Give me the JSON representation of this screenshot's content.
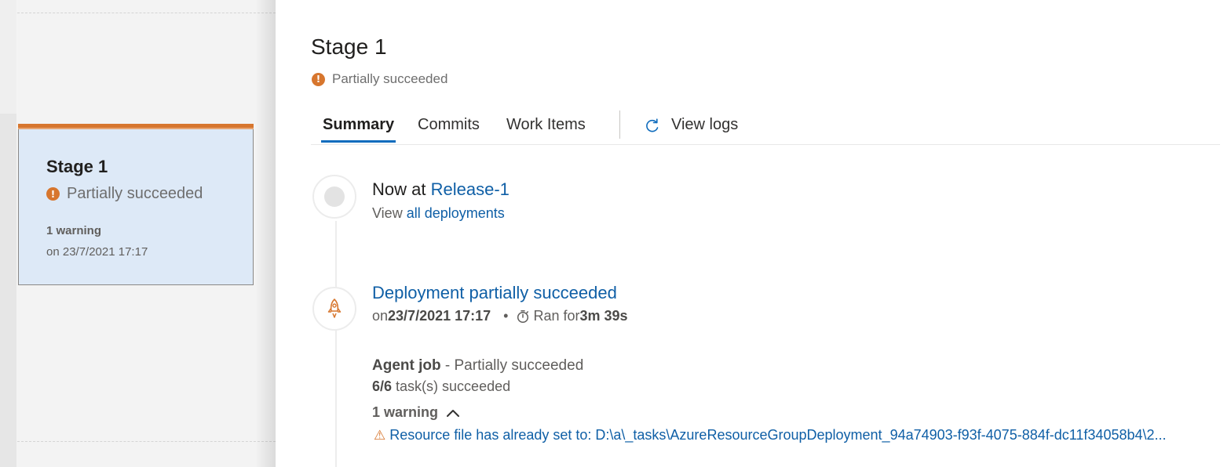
{
  "pipeline_card": {
    "title": "Stage 1",
    "status": "Partially succeeded",
    "warnings": "1 warning",
    "date": "on 23/7/2021 17:17",
    "status_color": "#d7762e"
  },
  "panel": {
    "title": "Stage 1",
    "status": "Partially succeeded",
    "tabs": [
      {
        "label": "Summary",
        "active": true
      },
      {
        "label": "Commits"
      },
      {
        "label": "Work Items"
      }
    ],
    "view_logs": "View logs",
    "now_at_prefix": "Now at",
    "release": "Release-1",
    "view_prefix": "View",
    "all_deployments": "all deployments",
    "deployment": {
      "title": "Deployment partially succeeded",
      "on_prefix": "on",
      "date": "23/7/2021 17:17",
      "bullet": "•",
      "ran_for_prefix": "Ran for",
      "duration": "3m 39s"
    },
    "agent_job": {
      "name": "Agent job",
      "separator": " - ",
      "status": "Partially succeeded",
      "tasks_count": "6/6",
      "tasks_label": "task(s) succeeded",
      "warnings": "1 warning",
      "warning_message": "Resource file has already set to: D:\\a\\_tasks\\AzureResourceGroupDeployment_94a74903-f93f-4075-884f-dc11f34058b4\\2..."
    }
  },
  "icons": {
    "status": "alert-circle-icon",
    "view_logs": "redo-arrow-icon",
    "deployment": "rocket-icon",
    "timer": "stopwatch-icon",
    "collapse": "chevron-up-icon",
    "warning": "warning-triangle-icon"
  },
  "colors": {
    "accent": "#0f6cbd",
    "link": "#0f5fa6",
    "partial": "#d7762e",
    "card_bg": "#dde9f7"
  }
}
